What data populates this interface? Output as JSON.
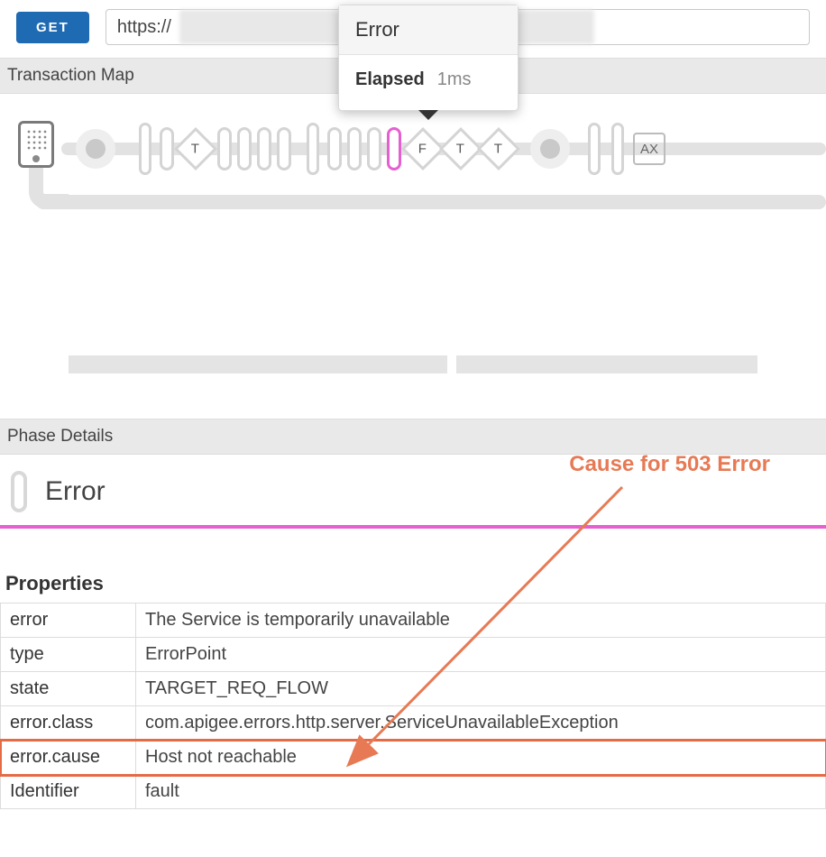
{
  "method": "GET",
  "url_value": "https://",
  "tooltip": {
    "title": "Error",
    "elapsed_label": "Elapsed",
    "elapsed_value": "1ms"
  },
  "sections": {
    "transaction_map": "Transaction Map",
    "phase_details": "Phase Details"
  },
  "phase": {
    "title": "Error"
  },
  "annotation": "Cause for 503 Error",
  "map_labels": {
    "diamond_T": "T",
    "diamond_F": "F",
    "square_AX": "AX"
  },
  "properties": {
    "heading": "Properties",
    "rows": [
      {
        "k": "error",
        "v": "The Service is temporarily unavailable"
      },
      {
        "k": "type",
        "v": "ErrorPoint"
      },
      {
        "k": "state",
        "v": "TARGET_REQ_FLOW"
      },
      {
        "k": "error.class",
        "v": "com.apigee.errors.http.server.ServiceUnavailableException"
      },
      {
        "k": "error.cause",
        "v": "Host not reachable",
        "highlight": true
      },
      {
        "k": "Identifier",
        "v": "fault"
      }
    ]
  }
}
